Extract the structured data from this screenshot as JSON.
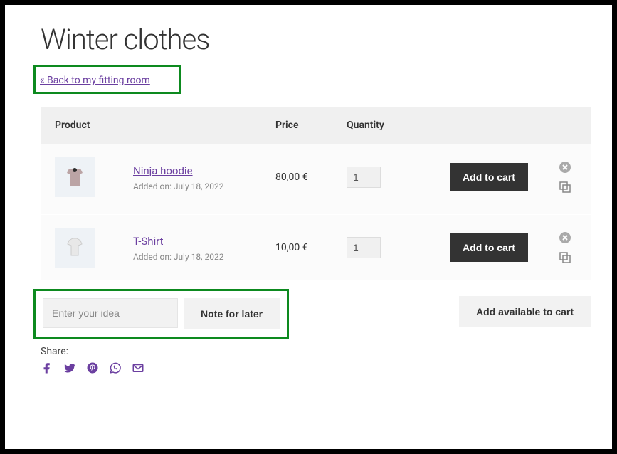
{
  "page": {
    "title": "Winter clothes",
    "back_link": "« Back to my fitting room"
  },
  "table": {
    "headers": {
      "product": "Product",
      "price": "Price",
      "quantity": "Quantity"
    },
    "rows": [
      {
        "name": "Ninja hoodie",
        "added": "Added on: July 18, 2022",
        "price": "80,00 €",
        "qty": "1",
        "action": "Add to cart"
      },
      {
        "name": "T-Shirt",
        "added": "Added on: July 18, 2022",
        "price": "10,00 €",
        "qty": "1",
        "action": "Add to cart"
      }
    ]
  },
  "note": {
    "placeholder": "Enter your idea",
    "button": "Note for later"
  },
  "bulk": {
    "add_available": "Add available to cart"
  },
  "share": {
    "label": "Share:"
  }
}
